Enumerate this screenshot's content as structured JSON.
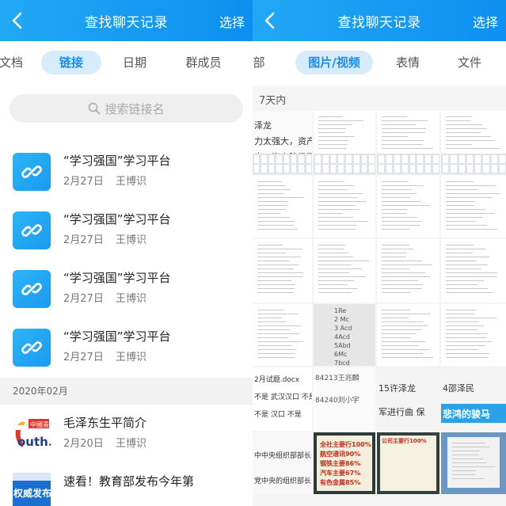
{
  "left": {
    "header": {
      "title": "查找聊天记录",
      "select_label": "选择"
    },
    "tabs": [
      {
        "label": "文档",
        "active": false
      },
      {
        "label": "链接",
        "active": true
      },
      {
        "label": "日期",
        "active": false
      },
      {
        "label": "群成员",
        "active": false
      }
    ],
    "search": {
      "placeholder": "搜索链接名"
    },
    "links": [
      {
        "title": "“学习强国”学习平台",
        "date": "2月27日",
        "sender": "王博识"
      },
      {
        "title": "“学习强国”学习平台",
        "date": "2月27日",
        "sender": "王博识"
      },
      {
        "title": "“学习强国”学习平台",
        "date": "2月27日",
        "sender": "王博识"
      },
      {
        "title": "“学习强国”学习平台",
        "date": "2月27日",
        "sender": "王博识"
      }
    ],
    "month_header": "2020年02月",
    "articles": [
      {
        "title": "毛泽东生平简介",
        "date": "2月20日",
        "sender": "王博识",
        "thumb_text_top": "中國青",
        "thumb_text_main": "outh."
      },
      {
        "title": "速看！教育部发布今年第",
        "date": "",
        "sender": "",
        "thumb_text_main": "权威发布"
      }
    ]
  },
  "right": {
    "header": {
      "title": "查找聊天记录",
      "select_label": "选择"
    },
    "tabs": [
      {
        "label": "部",
        "active": false
      },
      {
        "label": "图片/视频",
        "active": true
      },
      {
        "label": "表情",
        "active": false
      },
      {
        "label": "文件",
        "active": false
      }
    ],
    "section_label": "7天内",
    "thumb_texts": {
      "r1c1": [
        "泽龙",
        "力太强大，资产",
        "步，资产阶级不"
      ],
      "r4c2": [
        "1Re",
        "2 Mc",
        "3 Acd",
        "4Acd",
        "5Abd",
        "6Mc",
        "7bcd"
      ],
      "r5c1": [
        "2月试题.docx",
        "不是  武汉汉口  不是",
        "不是  汉口  不是"
      ],
      "r5c2": [
        "84213王兆麟",
        "84240刘小宇"
      ],
      "r5c3": [
        "15许泽龙",
        "军进行曲 保"
      ],
      "r5c4": [
        "4邵泽民",
        "悲鸿的骏马"
      ],
      "r6c1": [
        "中中央组织部部长",
        "党中央的组织部长"
      ],
      "r6c2": [
        "全社主要行100%",
        "航空通讯90%",
        "钢铁主要86%",
        "汽车主要67%",
        "有色金属85%"
      ],
      "r6c3": [
        "公司主要行100%"
      ]
    },
    "colors": {
      "accent": "#1a8de8",
      "header_start": "#21a8f5",
      "header_end": "#0e8ff0"
    }
  }
}
